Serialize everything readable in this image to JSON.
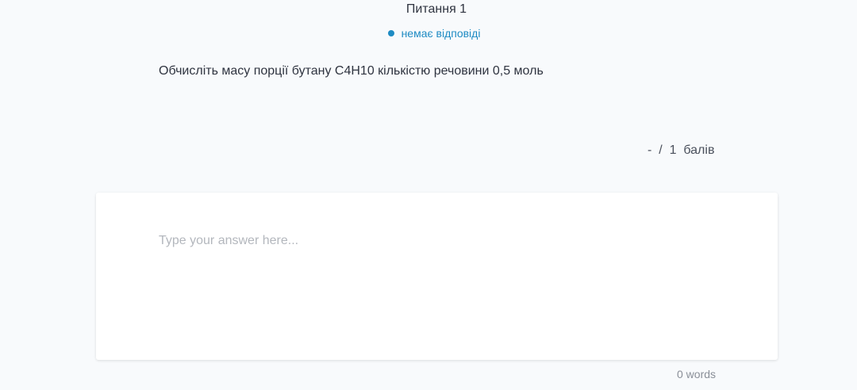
{
  "question": {
    "title": "Питання 1",
    "status_label": "немає відповіді",
    "text": "Обчисліть масу порції бутану C4H10 кількістю речовини 0,5 моль"
  },
  "score": {
    "earned": "-",
    "separator": "/",
    "max": "1",
    "unit": "балів"
  },
  "answer": {
    "placeholder": "Type your answer here...",
    "value": "",
    "word_count": "0 words"
  },
  "colors": {
    "accent": "#1e8bc3",
    "background": "#f8fafc",
    "card": "#ffffff"
  }
}
